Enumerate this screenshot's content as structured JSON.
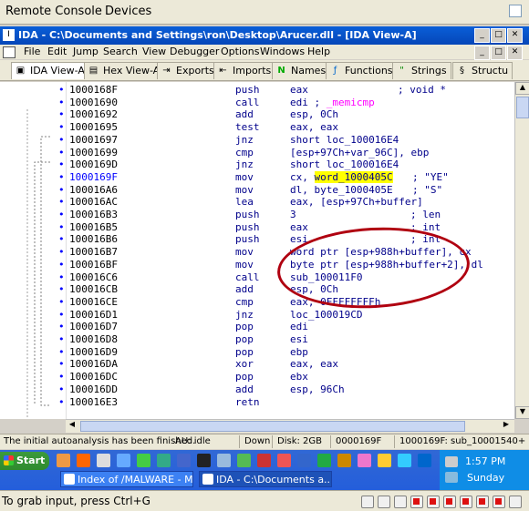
{
  "remote_console": {
    "menu": [
      "Remote Console",
      "Devices"
    ],
    "bottom_text": "To grab input, press Ctrl+G"
  },
  "ida": {
    "title": "IDA - C:\\Documents and Settings\\ron\\Desktop\\Arucer.dll - [IDA View-A]",
    "menu": [
      "File",
      "Edit",
      "Jump",
      "Search",
      "View",
      "Debugger",
      "Options",
      "Windows",
      "Help"
    ],
    "tabs": [
      {
        "label": "IDA View-A",
        "icon": "ida-view-icon"
      },
      {
        "label": "Hex View-A",
        "icon": "hex-view-icon"
      },
      {
        "label": "Exports",
        "icon": "exports-icon"
      },
      {
        "label": "Imports",
        "icon": "imports-icon"
      },
      {
        "label": "Names",
        "icon": "names-icon"
      },
      {
        "label": "Functions",
        "icon": "functions-icon"
      },
      {
        "label": "Strings",
        "icon": "strings-icon"
      },
      {
        "label": "Structu",
        "icon": "structures-icon"
      }
    ],
    "code": [
      {
        "addr": "1000168F",
        "mn": "push",
        "op": "eax",
        "cm": "; void *"
      },
      {
        "addr": "10001690",
        "mn": "call",
        "op": "edi ; _memicmp",
        "cm": ""
      },
      {
        "addr": "10001692",
        "mn": "add",
        "op": "esp, 0Ch",
        "cm": ""
      },
      {
        "addr": "10001695",
        "mn": "test",
        "op": "eax, eax",
        "cm": ""
      },
      {
        "addr": "10001697",
        "mn": "jnz",
        "op": "short loc_100016E4",
        "cm": ""
      },
      {
        "addr": "10001699",
        "mn": "cmp",
        "op": "[esp+97Ch+var_96C], ebp",
        "cm": ""
      },
      {
        "addr": "1000169D",
        "mn": "jnz",
        "op": "short loc_100016E4",
        "cm": ""
      },
      {
        "addr": "1000169F",
        "mn": "mov",
        "op": "cx, word_1000405C",
        "cm": "; \"YE\""
      },
      {
        "addr": "100016A6",
        "mn": "mov",
        "op": "dl, byte_1000405E",
        "cm": "; \"S\""
      },
      {
        "addr": "100016AC",
        "mn": "lea",
        "op": "eax, [esp+97Ch+buffer]",
        "cm": ""
      },
      {
        "addr": "100016B3",
        "mn": "push",
        "op": "3",
        "cm": "; len"
      },
      {
        "addr": "100016B5",
        "mn": "push",
        "op": "eax",
        "cm": "; int"
      },
      {
        "addr": "100016B6",
        "mn": "push",
        "op": "esi",
        "cm": "; int"
      },
      {
        "addr": "100016B7",
        "mn": "mov",
        "op": "word ptr [esp+988h+buffer], cx",
        "cm": ""
      },
      {
        "addr": "100016BF",
        "mn": "mov",
        "op": "byte ptr [esp+988h+buffer+2], dl",
        "cm": ""
      },
      {
        "addr": "100016C6",
        "mn": "call",
        "op": "sub_100011F0",
        "cm": ""
      },
      {
        "addr": "100016CB",
        "mn": "add",
        "op": "esp, 0Ch",
        "cm": ""
      },
      {
        "addr": "100016CE",
        "mn": "cmp",
        "op": "eax, 0FFFFFFFFh",
        "cm": ""
      },
      {
        "addr": "100016D1",
        "mn": "jnz",
        "op": "loc_100019CD",
        "cm": ""
      },
      {
        "addr": "100016D7",
        "mn": "pop",
        "op": "edi",
        "cm": ""
      },
      {
        "addr": "100016D8",
        "mn": "pop",
        "op": "esi",
        "cm": ""
      },
      {
        "addr": "100016D9",
        "mn": "pop",
        "op": "ebp",
        "cm": ""
      },
      {
        "addr": "100016DA",
        "mn": "xor",
        "op": "eax, eax",
        "cm": ""
      },
      {
        "addr": "100016DC",
        "mn": "pop",
        "op": "ebx",
        "cm": ""
      },
      {
        "addr": "100016DD",
        "mn": "add",
        "op": "esp, 96Ch",
        "cm": ""
      },
      {
        "addr": "100016E3",
        "mn": "retn",
        "op": "",
        "cm": ""
      }
    ],
    "status": [
      "The initial autoanalysis has been finished.",
      "AU:  idle",
      "Down",
      "Disk: 2GB",
      "0000169F",
      "1000169F: sub_10001540+"
    ]
  },
  "taskbar": {
    "start_label": "Start",
    "tasks": [
      "Index of /MALWARE - M...",
      "IDA - C:\\Documents a..."
    ],
    "time": "1:57 PM",
    "day": "Sunday"
  },
  "colors": {
    "title_blue": "#0546b8",
    "taskbar_blue": "#245edb",
    "annotation_red": "#b00010",
    "highlight_yellow": "#ffff00"
  }
}
